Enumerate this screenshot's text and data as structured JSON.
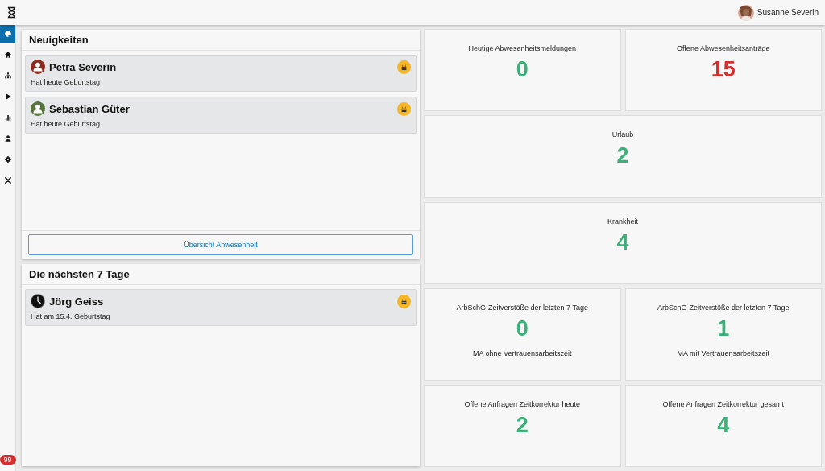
{
  "topbar": {
    "user_name": "Susanne Severin"
  },
  "sidebar": {
    "items": [
      {
        "selected": true
      },
      {
        "selected": false
      },
      {
        "selected": false
      },
      {
        "selected": false
      },
      {
        "selected": false
      },
      {
        "selected": false
      },
      {
        "selected": false
      },
      {
        "selected": false
      }
    ],
    "badge": "99"
  },
  "news": {
    "title": "Neuigkeiten",
    "items": [
      {
        "name": "Petra Severin",
        "text": "Hat heute Geburtstag",
        "kind": "person",
        "color": "#8e2a1e"
      },
      {
        "name": "Sebastian Güter",
        "text": "Hat heute Geburtstag",
        "kind": "person",
        "color": "#55733a"
      }
    ],
    "button": "Übersicht Anwesenheit"
  },
  "upcoming": {
    "title": "Die nächsten 7 Tage",
    "items": [
      {
        "name": "Jörg Geiss",
        "text": "Hat am 15.4. Geburtstag",
        "kind": "clock",
        "color": "#111111"
      }
    ]
  },
  "tile_rows": [
    [
      {
        "title": "Heutige Abwesenheitsmeldungen",
        "value": "0",
        "color": "#3daf78"
      },
      {
        "title": "Offene Abwesenheitsanträge",
        "value": "15",
        "color": "#d32f2f"
      }
    ],
    [
      {
        "title": "Urlaub",
        "value": "2",
        "color": "#3daf78"
      }
    ],
    [
      {
        "title": "Krankheit",
        "value": "4",
        "color": "#3daf78"
      }
    ],
    [
      {
        "title": "ArbSchG-Zeitverstöße der letzten 7 Tage",
        "value": "0",
        "color": "#3daf78",
        "subtitle": "MA ohne Vertrauensarbeitszeit"
      },
      {
        "title": "ArbSchG-Zeitverstöße der letzten 7 Tage",
        "value": "1",
        "color": "#3daf78",
        "subtitle": "MA mit Vertrauensarbeitszeit"
      }
    ],
    [
      {
        "title": "Offene Anfragen Zeitkorrektur heute",
        "value": "2",
        "color": "#3daf78"
      },
      {
        "title": "Offene Anfragen Zeitkorrektur gesamt",
        "value": "4",
        "color": "#3daf78"
      }
    ]
  ]
}
